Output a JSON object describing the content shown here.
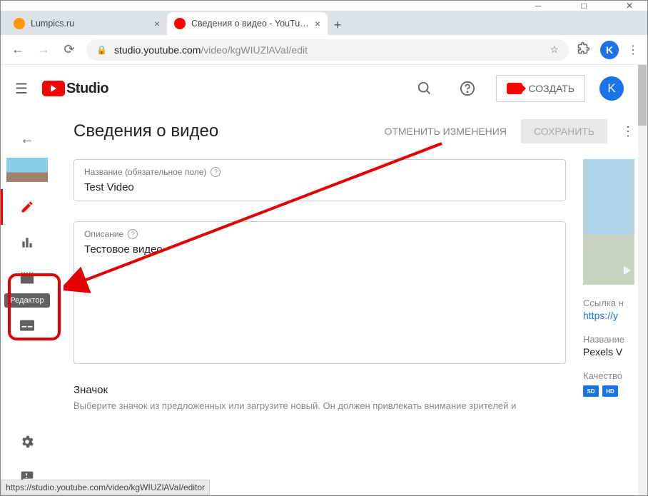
{
  "window": {
    "tabs": [
      {
        "title": "Lumpics.ru",
        "favicon_color": "#ff9800"
      },
      {
        "title": "Сведения о видео - YouTube St",
        "favicon_color": "#ff0000"
      }
    ]
  },
  "omnibox": {
    "host": "studio.youtube.com",
    "path": "/video/kgWIUZlAVaI/edit"
  },
  "profile_initial": "K",
  "studio": {
    "logo_text": "Studio",
    "create_label": "СОЗДАТЬ",
    "avatar_initial": "K"
  },
  "sidebar": {
    "tooltip_editor": "Редактор"
  },
  "page": {
    "title": "Сведения о видео",
    "cancel": "ОТМЕНИТЬ ИЗМЕНЕНИЯ",
    "save": "СОХРАНИТЬ",
    "field_title_label": "Название (обязательное поле)",
    "field_title_value": "Test Video",
    "field_desc_label": "Описание",
    "field_desc_value": "Тестовое видео",
    "thumb_title": "Значок",
    "thumb_desc": "Выберите значок из предложенных или загрузите новый. Он должен привлекать внимание зрителей и"
  },
  "right": {
    "link_label": "Ссылка н",
    "link_value": "https://y",
    "name_label": "Название",
    "name_value": "Pexels V",
    "quality_label": "Качество",
    "quality_badges": [
      "SD",
      "HD"
    ]
  },
  "status_url": "https://studio.youtube.com/video/kgWIUZlAVaI/editor"
}
